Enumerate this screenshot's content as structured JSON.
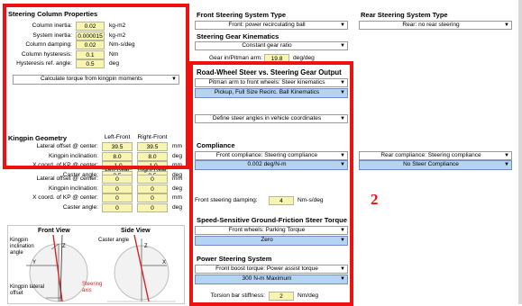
{
  "steering_column": {
    "title": "Steering Column Properties",
    "rows": [
      {
        "label": "Column inertia:",
        "value": "0.02",
        "unit": "kg-m2"
      },
      {
        "label": "System inertia:",
        "value": "0.000015",
        "unit": "kg-m2"
      },
      {
        "label": "Column damping:",
        "value": "0.02",
        "unit": "Nm-s/deg"
      },
      {
        "label": "Column hysteresis:",
        "value": "0.1",
        "unit": "Nm"
      },
      {
        "label": "Hysteresis ref. angle:",
        "value": "0.5",
        "unit": "deg"
      }
    ],
    "calc_button": "Calculate torque from kingpin moments"
  },
  "kingpin": {
    "title": "Kingpin Geometry",
    "front_headers": [
      "Left-Front",
      "Right-Front"
    ],
    "front_rows": [
      {
        "label": "Lateral offset @ center:",
        "l": "39.5",
        "r": "39.5",
        "unit": "mm"
      },
      {
        "label": "Kingpin inclination:",
        "l": "8.0",
        "r": "8.0",
        "unit": "deg"
      },
      {
        "label": "X coord. of KP @ center:",
        "l": "-1.0",
        "r": "-1.0",
        "unit": "mm"
      },
      {
        "label": "Caster angle:",
        "l": "3.5",
        "r": "3.5",
        "unit": "deg"
      }
    ],
    "rear_headers": [
      "Left-Rear",
      "Right-Rear"
    ],
    "rear_rows": [
      {
        "label": "Lateral offset @ center:",
        "l": "0",
        "r": "0",
        "unit": "mm"
      },
      {
        "label": "Kingpin inclination:",
        "l": "0",
        "r": "0",
        "unit": "deg"
      },
      {
        "label": "X coord. of KP @ center:",
        "l": "0",
        "r": "0",
        "unit": "mm"
      },
      {
        "label": "Caster angle:",
        "l": "0",
        "r": "0",
        "unit": "deg"
      }
    ]
  },
  "diagram": {
    "front_title": "Front View",
    "side_title": "Side View",
    "kingpin_inclination": "Kingpin\ninclination\nangle",
    "caster_angle": "Caster angle",
    "kingpin_lateral": "Kingpin lateral\noffset",
    "steering_axis": "Steering\naxis",
    "z": "Z",
    "y": "Y",
    "x": "X"
  },
  "front_steering": {
    "title": "Front Steering System Type",
    "selected": "Front: power recirculating ball",
    "kinematics_title": "Steering Gear Kinematics",
    "kinematics_selected": "Constant gear ratio",
    "gear_label": "Gear in/Pitman arm:",
    "gear_value": "19.8",
    "gear_unit": "deg/deg",
    "road_wheel_title": "Road-Wheel Steer vs. Steering Gear Output",
    "pitman_dd": "Pitman arm to front wheels: Steer kinematics",
    "pitman_sel": "Pickup, Full Size Recirc. Ball Kinematics",
    "define_dd": "Define steer angles in vehicle coordinates",
    "compliance_title": "Compliance",
    "compliance_dd": "Front compliance: Steering compliance",
    "compliance_sel": "0.002 deg/N-m",
    "damping_label": "Front steering damping:",
    "damping_value": "4",
    "damping_unit": "Nm-s/deg",
    "speed_title": "Speed-Sensitive Ground-Friction Steer Torque",
    "speed_dd": "Front wheels: Parking Torque",
    "speed_sel": "Zero",
    "power_title": "Power Steering System",
    "power_dd": "Front boost torque: Power assist torque",
    "power_sel": "300 N-m Maximum",
    "torsion_label": "Torsion bar stiffness:",
    "torsion_value": "2",
    "torsion_unit": "Nm/deg"
  },
  "rear_steering": {
    "title": "Rear Steering System Type",
    "selected": "Rear: no rear steering",
    "compliance_dd": "Rear compliance: Steering compliance",
    "compliance_sel": "No Steer Compliance"
  },
  "annotation": {
    "number": "2",
    "color": "#ee1111"
  },
  "colors": {
    "highlight_box": "#ee1111",
    "input_field": "#f7f5b0",
    "selected_dropdown": "#b5d3f3"
  }
}
